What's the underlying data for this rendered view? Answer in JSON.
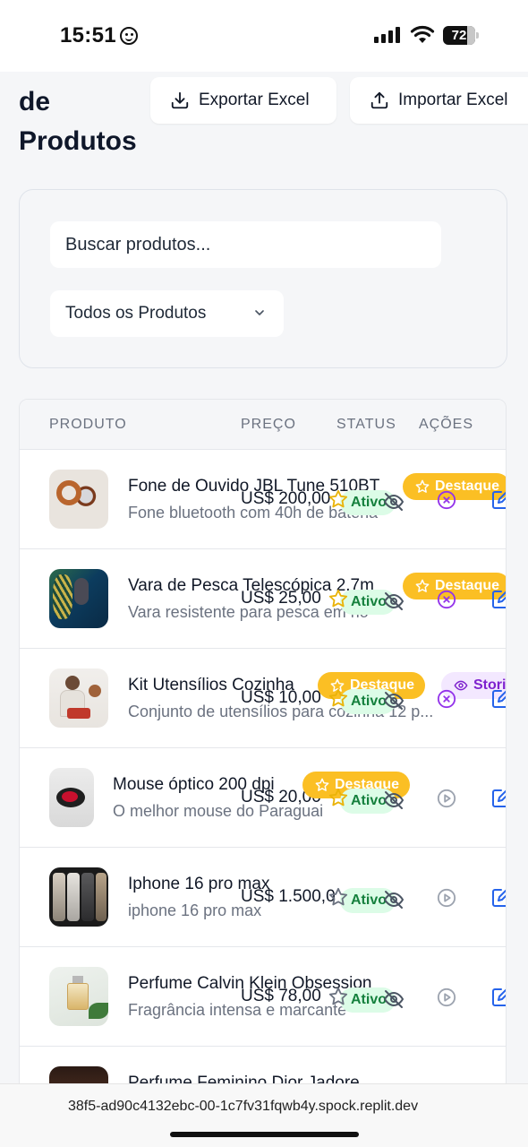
{
  "status_bar": {
    "time": "15:51",
    "battery": "72"
  },
  "header": {
    "title_line1": "de",
    "title_line2": "Produtos",
    "export_label": "Exportar Excel",
    "import_label": "Importar Excel"
  },
  "filters": {
    "search_placeholder": "Buscar produtos...",
    "category_selected": "Todos os Produtos"
  },
  "table": {
    "columns": [
      "PRODUTO",
      "PREÇO",
      "STATUS",
      "AÇÕES"
    ],
    "rows": [
      {
        "name": "Fone de Ouvido JBL Tune 510BT",
        "description": "Fone bluetooth com 40h de bateria",
        "price": "US$ 200,00",
        "status": "Ativo",
        "badge": "Destaque",
        "action": "x-circle"
      },
      {
        "name": "Vara de Pesca Telescópica 2,7m",
        "description": "Vara resistente para pesca em rio",
        "price": "US$ 25,00",
        "status": "Ativo",
        "badge": "Destaque",
        "action": "x-circle"
      },
      {
        "name": "Kit Utensílios Cozinha",
        "description": "Conjunto de utensílios para cozinha 12 p...",
        "price": "US$ 10,00",
        "status": "Ativo",
        "badge": "Destaque",
        "badge2": "Stori",
        "action": "x-circle"
      },
      {
        "name": "Mouse óptico 200 dpi",
        "description": "O melhor mouse do Paraguai",
        "price": "US$ 20,00",
        "status": "Ativo",
        "badge": "Destaque",
        "action": "play-circle"
      },
      {
        "name": "Iphone 16 pro max",
        "description": "iphone 16 pro max",
        "price": "US$ 1.500,0",
        "status": "Ativo",
        "action": "play-circle"
      },
      {
        "name": "Perfume Calvin Klein Obsession",
        "description": "Fragrância intensa e marcante",
        "price": "US$ 78,00",
        "status": "Ativo",
        "action": "play-circle"
      },
      {
        "name": "Perfume Feminino Dior Jadore",
        "description": "",
        "price": "",
        "status": ""
      }
    ]
  },
  "browser": {
    "url": "38f5-ad90c4132ebc-00-1c7fv31fqwb4y.spock.replit.dev"
  },
  "colors": {
    "accent": "#2563eb",
    "destaque": "#fbbf24",
    "status_bg": "#dcfce7",
    "status_text": "#15803d",
    "pause_icon": "#9333ea"
  }
}
